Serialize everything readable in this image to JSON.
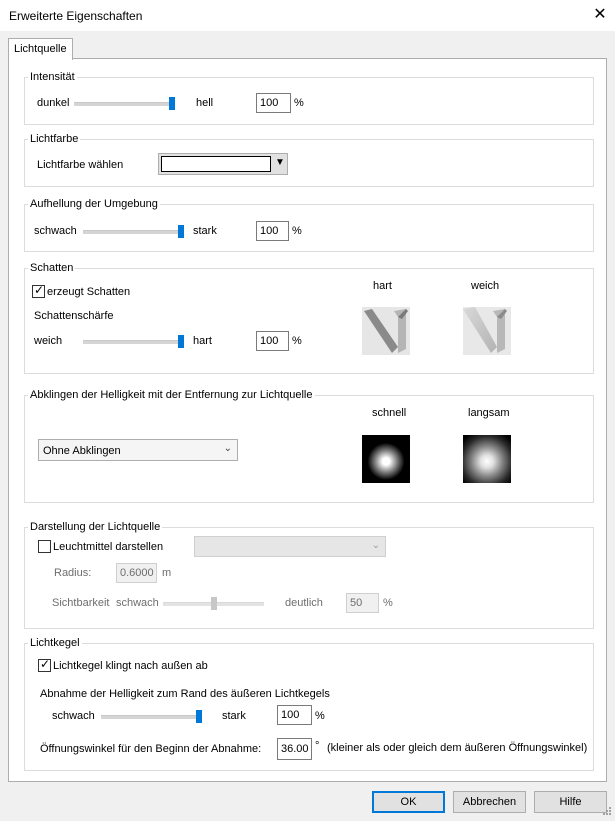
{
  "window": {
    "title": "Erweiterte Eigenschaften",
    "close_glyph": "✕"
  },
  "tab": {
    "label": "Lichtquelle"
  },
  "intensity": {
    "group": "Intensität",
    "left": "dunkel",
    "right": "hell",
    "value": "100",
    "unit": "%",
    "slider_fraction": 1.0
  },
  "lightcolor": {
    "group": "Lichtfarbe",
    "label": "Lichtfarbe wählen",
    "color": "#ffffff"
  },
  "ambient": {
    "group": "Aufhellung der Umgebung",
    "left": "schwach",
    "right": "stark",
    "value": "100",
    "unit": "%",
    "slider_fraction": 1.0
  },
  "shadow": {
    "group": "Schatten",
    "checkbox": "erzeugt Schatten",
    "checked": true,
    "sharpness": "Schattenschärfe",
    "left": "weich",
    "right": "hart",
    "value": "100",
    "unit": "%",
    "slider_fraction": 1.0,
    "preview_hard": "hart",
    "preview_soft": "weich"
  },
  "falloff": {
    "group": "Abklingen der Helligkeit mit der Entfernung zur Lichtquelle",
    "selected": "Ohne Abklingen",
    "preview_fast": "schnell",
    "preview_slow": "langsam"
  },
  "display": {
    "group": "Darstellung der Lichtquelle",
    "checkbox": "Leuchtmittel darstellen",
    "checked": false,
    "radius_label": "Radius:",
    "radius_value": "0.6000",
    "radius_unit": "m",
    "visibility_label": "Sichtbarkeit",
    "left": "schwach",
    "right": "deutlich",
    "value": "50",
    "unit": "%",
    "slider_fraction": 0.5
  },
  "cone": {
    "group": "Lichtkegel",
    "checkbox": "Lichtkegel klingt nach außen ab",
    "checked": true,
    "falloff_label": "Abnahme der Helligkeit zum Rand des äußeren Lichtkegels",
    "left": "schwach",
    "right": "stark",
    "value": "100",
    "unit": "%",
    "slider_fraction": 1.0,
    "angle_label": "Öffnungswinkel für den Beginn der Abnahme:",
    "angle_value": "36.00",
    "angle_unit": "°",
    "angle_note": "(kleiner als oder gleich dem äußeren Öffnungswinkel)"
  },
  "buttons": {
    "ok": "OK",
    "cancel": "Abbrechen",
    "help": "Hilfe"
  },
  "icons": {
    "close": "close-icon",
    "chevron": "chevron-down-icon",
    "check": "checkmark-icon"
  }
}
